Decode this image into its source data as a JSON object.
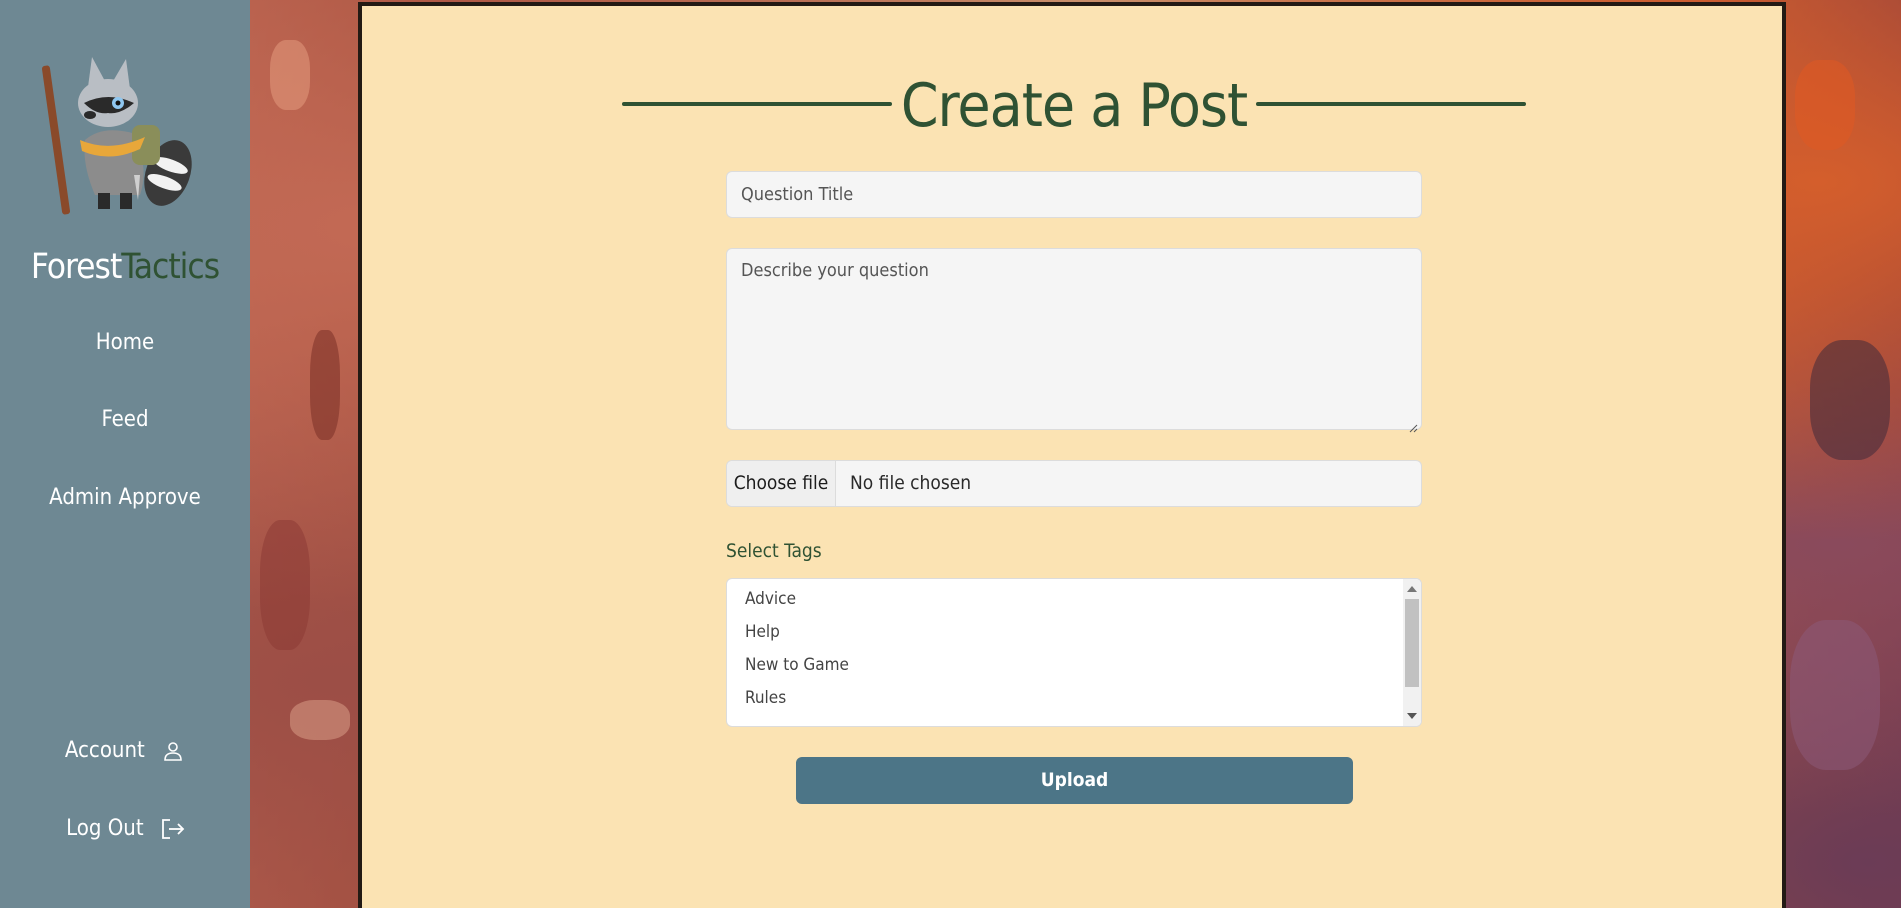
{
  "app": {
    "brand_part1": "Forest",
    "brand_part2": "Tactics",
    "logo_icon": "raccoon-adventurer-mascot"
  },
  "sidebar": {
    "nav": [
      {
        "label": "Home"
      },
      {
        "label": "Feed"
      },
      {
        "label": "Admin Approve"
      }
    ],
    "account_label": "Account",
    "account_icon": "user-icon",
    "logout_label": "Log Out",
    "logout_icon": "logout-icon"
  },
  "form": {
    "page_title": "Create a Post",
    "title_placeholder": "Question Title",
    "description_placeholder": "Describe your question",
    "file_button_label": "Choose file",
    "file_status": "No file chosen",
    "tags_label": "Select Tags",
    "tags_options": [
      "Advice",
      "Help",
      "New to Game",
      "Rules"
    ],
    "submit_label": "Upload"
  },
  "colors": {
    "sidebar_bg": "#6e8893",
    "accent_green": "#2f5233",
    "paper_bg": "#fbe3b3",
    "button_bg": "#4c7587"
  }
}
